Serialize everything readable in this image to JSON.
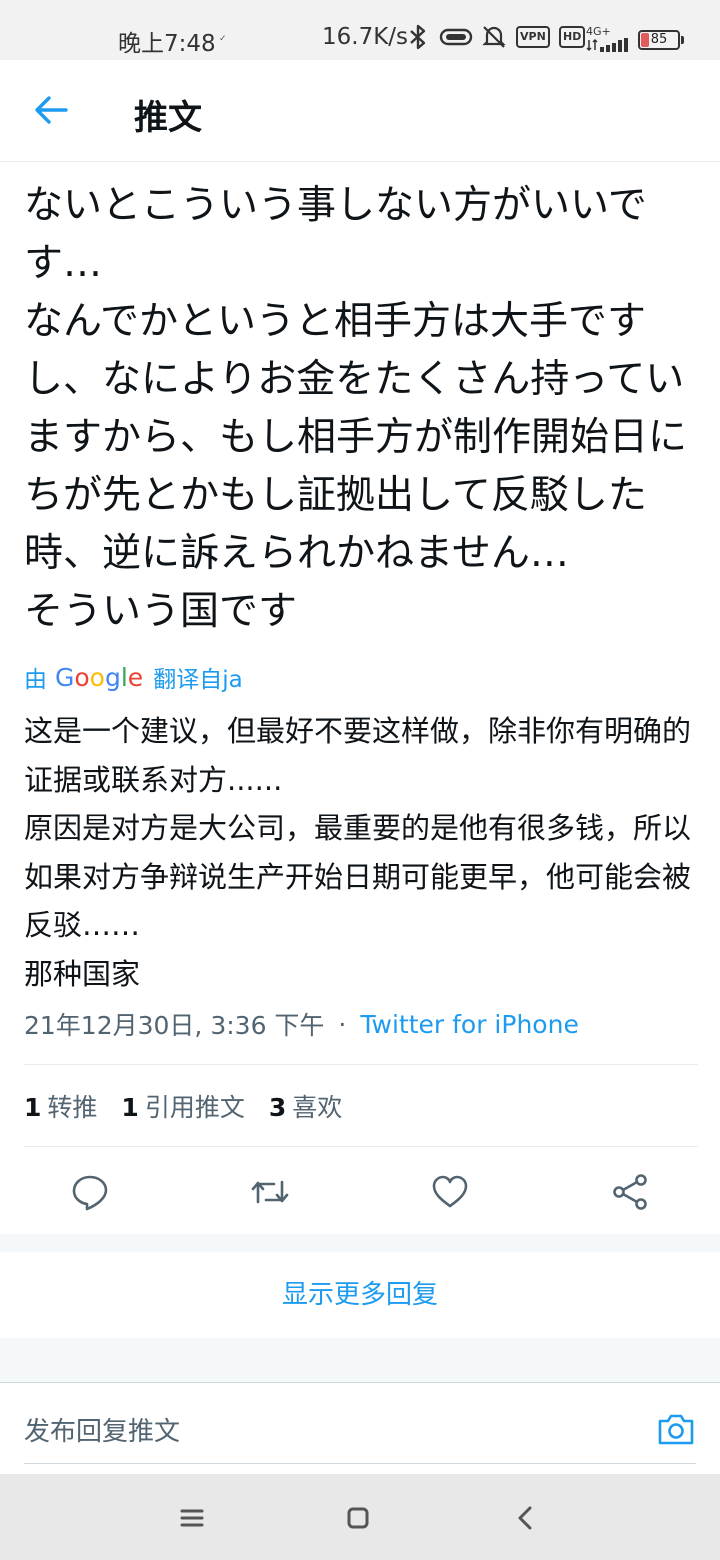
{
  "status_bar": {
    "time": "晚上7:48",
    "tiny": "✓",
    "speed": "16.7K/s",
    "vpn": "VPN",
    "hd": "HD",
    "network": "4G+",
    "battery": "85"
  },
  "header": {
    "title": "推文"
  },
  "tweet": {
    "text": "ないとこういう事しない方がいいです…\nなんでかというと相手方は大手ですし、なによりお金をたくさん持っていますから、もし相手方が制作開始日にちが先とかもし証拠出して反駁した時、逆に訴えられかねません…\nそういう国です",
    "translate_prefix": "由",
    "translate_brand": "Google",
    "translate_suffix": "翻译自ja",
    "translated_text": "这是一个建议，但最好不要这样做，除非你有明确的证据或联系对方......\n原因是对方是大公司，最重要的是他有很多钱，所以如果对方争辩说生产开始日期可能更早，他可能会被反驳……\n那种国家",
    "timestamp": "21年12月30日, 3:36 下午",
    "separator": "·",
    "source": "Twitter for iPhone"
  },
  "stats": [
    {
      "count": "1",
      "label": "转推"
    },
    {
      "count": "1",
      "label": "引用推文"
    },
    {
      "count": "3",
      "label": "喜欢"
    }
  ],
  "actions": {
    "reply_icon": "reply-icon",
    "retweet_icon": "retweet-icon",
    "like_icon": "heart-icon",
    "share_icon": "share-icon"
  },
  "more_replies": "显示更多回复",
  "composer": {
    "placeholder": "发布回复推文"
  },
  "colors": {
    "accent": "#1d9bf0",
    "text": "#0f1419",
    "muted": "#536471"
  }
}
